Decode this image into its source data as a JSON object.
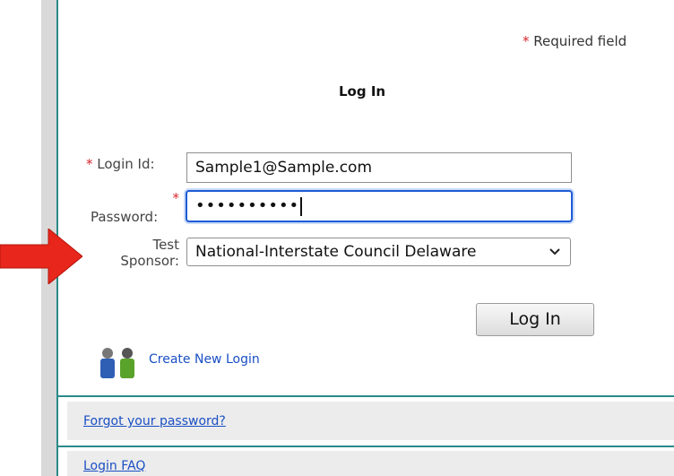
{
  "required": {
    "star": "*",
    "text": "Required field"
  },
  "title": "Log In",
  "form": {
    "login_star": "*",
    "login_label": "Login Id:",
    "login_value": "Sample1@Sample.com",
    "password_star": "*",
    "password_label": "Password:",
    "password_value": "••••••••••",
    "sponsor_label_line1": "Test",
    "sponsor_label_line2": "Sponsor:",
    "sponsor_value": "National-Interstate Council Delaware"
  },
  "button": {
    "login_label": "Log In"
  },
  "links": {
    "create": "Create New Login",
    "forgot": "Forgot your password?",
    "faq": "Login FAQ"
  },
  "icons": {
    "arrow": "red-arrow-icon",
    "people": "people-icon",
    "chevron": "chevron-down-icon"
  },
  "colors": {
    "accent_border": "#2b8a8a",
    "required_star": "#d8262e",
    "link": "#1a4fc4",
    "focus_ring": "#1e5bd6",
    "arrow": "#e8261b"
  }
}
